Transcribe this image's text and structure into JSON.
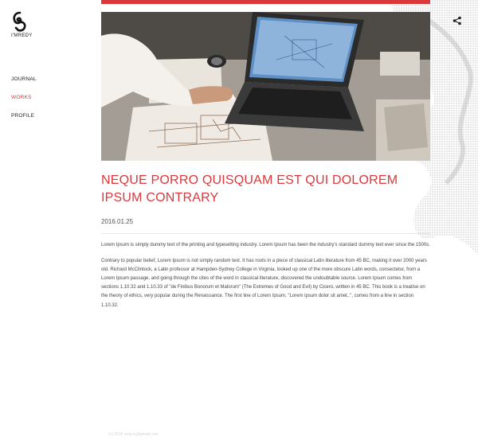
{
  "brand": {
    "logo_text": "I'MREDY"
  },
  "nav": {
    "items": [
      {
        "label": "JOURNAL"
      },
      {
        "label": "WORKS",
        "active": true
      },
      {
        "label": "PROFILE"
      }
    ]
  },
  "share": {
    "icon": "share-icon"
  },
  "hero": {
    "description": "photo of a person drafting architectural plans next to a laptop"
  },
  "post": {
    "title_line1": "NEQUE PORRO QUISQUAM EST QUI DOLOREM",
    "title_line2": "IPSUM CONTRARY",
    "date": "2016.01.25",
    "paragraph1": "Lorem Ipsum is simply dummy text of the printing and typesetting industry. Lorem Ipsum has been the industry's standard dummy text ever since the 1500s.",
    "paragraph2": "Contrary to popular belief, Lorem Ipsum is not simply random text. It has roots in a piece of classical Latin literature from 45 BC, making it over 2000 years old. Richard McClintock, a Latin professor at Hampden-Sydney College in Virginia, looked up one of the more obscure Latin words, consectetur, from a Lorem Ipsum passage, and going through the cites of the word in classical literature, discovered the undoubtable source. Lorem Ipsum comes from sections 1.10.32 and 1.10.33 of \"de Finibus Bonorum et Malorum\" (The Extremes of Good and Evil) by Cicero, written in 45 BC. This book is a treatise on the theory of ethics, very popular during the Renaissance. The first line of Lorem Ipsum, \"Lorem ipsum dolor sit amet..\", comes from a line in section 1.10.32."
  },
  "footer": {
    "text": "(c) 2016 redy.ru@gmail.com"
  },
  "colors": {
    "accent": "#d9393b",
    "text": "#333333",
    "background": "#ffffff"
  }
}
